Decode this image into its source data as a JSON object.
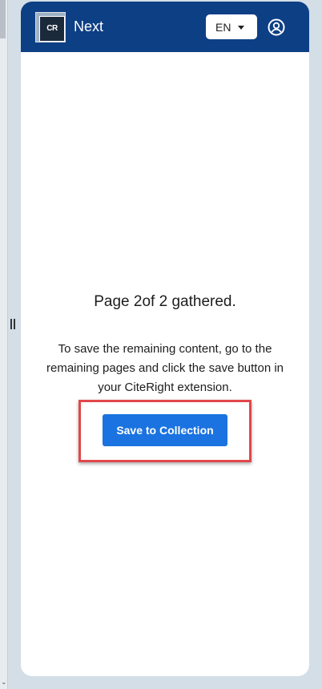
{
  "header": {
    "logo_text": "CR",
    "title": "Next",
    "language": "EN"
  },
  "main": {
    "status_prefix": "Page",
    "current_page": "2",
    "status_middle": "of",
    "total_pages": "2",
    "status_suffix": "gathered.",
    "instructions": "To save the remaining content, go to the remaining pages and click the save button in your CiteRight extension.",
    "save_button_label": "Save to Collection"
  },
  "colors": {
    "header_bg": "#0d3f85",
    "button_bg": "#1a73e0",
    "highlight_border": "#e2474b"
  },
  "icons": {
    "account": "user-circle-icon",
    "language_caret": "caret-down-icon"
  }
}
